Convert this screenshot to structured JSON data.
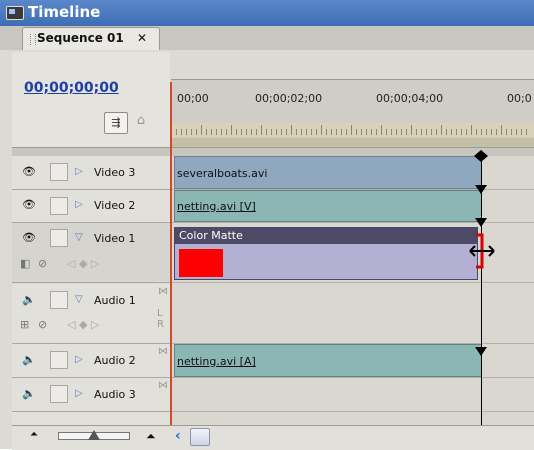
{
  "window": {
    "title": "Timeline",
    "icon": "timeline-window-icon"
  },
  "tab": {
    "label": "Sequence 01",
    "close": "✕"
  },
  "timecode": "00;00;00;00",
  "ruler": {
    "labels": [
      "00;00",
      "00;00;02;00",
      "00;00;04;00",
      "00;0"
    ]
  },
  "tracks": [
    {
      "name": "Video 3",
      "type": "video",
      "expanded": false,
      "clip": "severalboats.avi"
    },
    {
      "name": "Video 2",
      "type": "video",
      "expanded": false,
      "clip": "netting.avi [V]"
    },
    {
      "name": "Video 1",
      "type": "video",
      "expanded": true,
      "clip": "Color Matte"
    },
    {
      "name": "Audio 1",
      "type": "audio",
      "expanded": true,
      "clip": "",
      "channels": "L R"
    },
    {
      "name": "Audio 2",
      "type": "audio",
      "expanded": false,
      "clip": "netting.avi [A]"
    },
    {
      "name": "Audio 3",
      "type": "audio",
      "expanded": false,
      "clip": ""
    }
  ],
  "colors": {
    "title_bar": "#4a78bf",
    "playhead": "#d24a2a",
    "matte": "#ff0000",
    "matte_header": "#4c4a66"
  },
  "icons": {
    "eye": "eye-icon",
    "speaker": "speaker-icon",
    "lock": "lock-icon",
    "expand": "triangle-icon",
    "trim": "trim-cursor-icon"
  }
}
